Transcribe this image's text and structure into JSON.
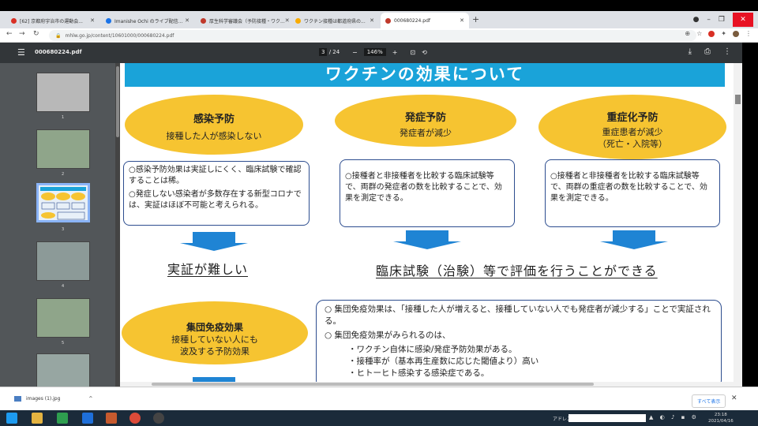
{
  "browser": {
    "tabs": [
      {
        "label": "[62] 京都府宇治市の運動会...",
        "color": "#d93025"
      },
      {
        "label": "Imanishe Ochi のライブ配信...",
        "color": "#1a73e8"
      },
      {
        "label": "厚生科学審議会（予防接種・ワク...",
        "color": "#c0392b"
      },
      {
        "label": "ワクチン接種は都道府県の...",
        "color": "#f9ab00"
      },
      {
        "label": "000680224.pdf",
        "color": "#c0392b"
      }
    ],
    "new_tab": "+",
    "url": "mhlw.go.jp/content/10601000/000680224.pdf"
  },
  "pdf_toolbar": {
    "filename": "000680224.pdf",
    "current_page": "3",
    "total_pages": "/ 24",
    "zoom": "146%",
    "zoom_out": "−",
    "zoom_in": "+"
  },
  "thumbnails": [
    "1",
    "2",
    "3",
    "4",
    "5"
  ],
  "slide": {
    "title": "ワクチンの効果について",
    "infection": {
      "heading": "感染予防",
      "subtitle": "接種した人が感染しない",
      "note_1": "○感染予防効果は実証しにくく、臨床試験で確認することは稀。",
      "note_2": "○発症しない感染者が多数存在する新型コロナでは、実証はほぼ不可能と考えられる。"
    },
    "onset": {
      "heading": "発症予防",
      "subtitle": "発症者が減少",
      "note": "○接種者と非接種者を比較する臨床試験等で、両群の発症者の数を比較することで、効果を測定できる。"
    },
    "severe": {
      "heading": "重症化予防",
      "subtitle_1": "重症患者が減少",
      "subtitle_2": "（死亡・入院等）",
      "note": "○接種者と非接種者を比較する臨床試験等で、両群の重症者の数を比較することで、効果を測定できる。"
    },
    "hard_to_prove": "実証が難しい",
    "clinical_eval": "臨床試験（治験）等で評価を行うことができる",
    "herd": {
      "heading": "集団免疫効果",
      "subtitle_1": "接種していない人にも",
      "subtitle_2": "波及する予防効果",
      "note_1": "○ 集団免疫効果は、「接種した人が増えると、接種していない人でも発症者が減少する」ことで実証される。",
      "note_2": "○ 集団免疫効果がみられるのは、",
      "bullet_1": "・ワクチン自体に感染/発症予防効果がある。",
      "bullet_2": "・接種率が（基本再生産数に応じた閾値より）高い",
      "bullet_3": "・ヒトーヒト感染する感染症である。"
    }
  },
  "download_bar": {
    "file": "images (1).jpg",
    "show_all": "すべて表示"
  },
  "taskbar": {
    "address_label": "アドレス",
    "time": "23:18",
    "date": "2021/04/16"
  }
}
